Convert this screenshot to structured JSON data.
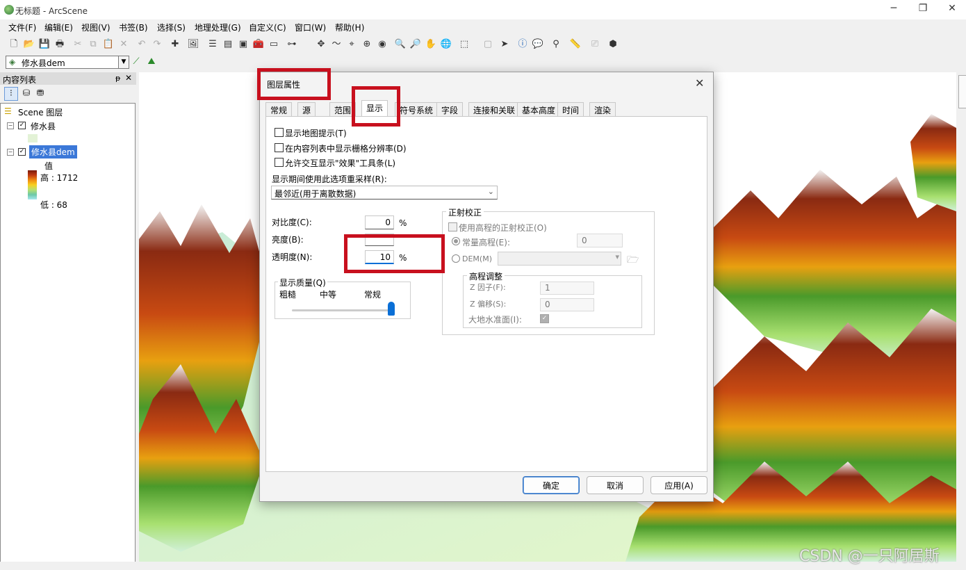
{
  "app": {
    "title": "无标题 - ArcScene",
    "minimize": "─",
    "maximize": "❐",
    "close": "✕"
  },
  "menu": [
    "文件(F)",
    "编辑(E)",
    "视图(V)",
    "书签(B)",
    "选择(S)",
    "地理处理(G)",
    "自定义(C)",
    "窗口(W)",
    "帮助(H)"
  ],
  "layer_selector": {
    "value": "修水县dem"
  },
  "toc": {
    "title": "内容列表",
    "pin": "ᵽ",
    "close": "✕",
    "root": "Scene 图层",
    "layers": [
      {
        "name": "修水县",
        "checked": true
      },
      {
        "name": "修水县dem",
        "checked": true,
        "selected": true
      }
    ],
    "legend_label": "值",
    "legend_high": "高 : 1712",
    "legend_low": "低 : 68"
  },
  "dialog": {
    "title": "图层属性",
    "close": "✕",
    "tabs": [
      "常规",
      "源",
      "范围",
      "显示",
      "符号系统",
      "字段",
      "连接和关联",
      "基本高度",
      "时间",
      "渲染"
    ],
    "active_tab": "显示",
    "checkboxes": [
      "显示地图提示(T)",
      "在内容列表中显示栅格分辨率(D)",
      "允许交互显示\"效果\"工具条(L)"
    ],
    "resample_label": "显示期间使用此选项重采样(R):",
    "resample_value": "最邻近(用于离散数据)",
    "contrast_label": "对比度(C):",
    "contrast_value": "0",
    "brightness_label": "亮度(B):",
    "transparency_label": "透明度(N):",
    "transparency_value": "10",
    "percent": "%",
    "quality_group": "显示质量(Q)",
    "quality_coarse": "粗糙",
    "quality_medium": "中等",
    "quality_normal": "常规",
    "ortho_group": "正射校正",
    "ortho_use": "使用高程的正射校正(O)",
    "const_elev": "常量高程(E):",
    "const_elev_value": "0",
    "dem_label": "DEM(M)",
    "elev_adjust": "高程调整",
    "z_factor": "Z 因子(F):",
    "z_factor_value": "1",
    "z_offset": "Z 偏移(S):",
    "z_offset_value": "0",
    "geoid": "大地水准面(I):",
    "ok": "确定",
    "cancel": "取消",
    "apply": "应用(A)"
  },
  "watermark": "CSDN @一只阿居斯",
  "colors": {
    "highlight": "#c8101e",
    "selection": "#3b78d8",
    "accent": "#0a6fd6"
  }
}
